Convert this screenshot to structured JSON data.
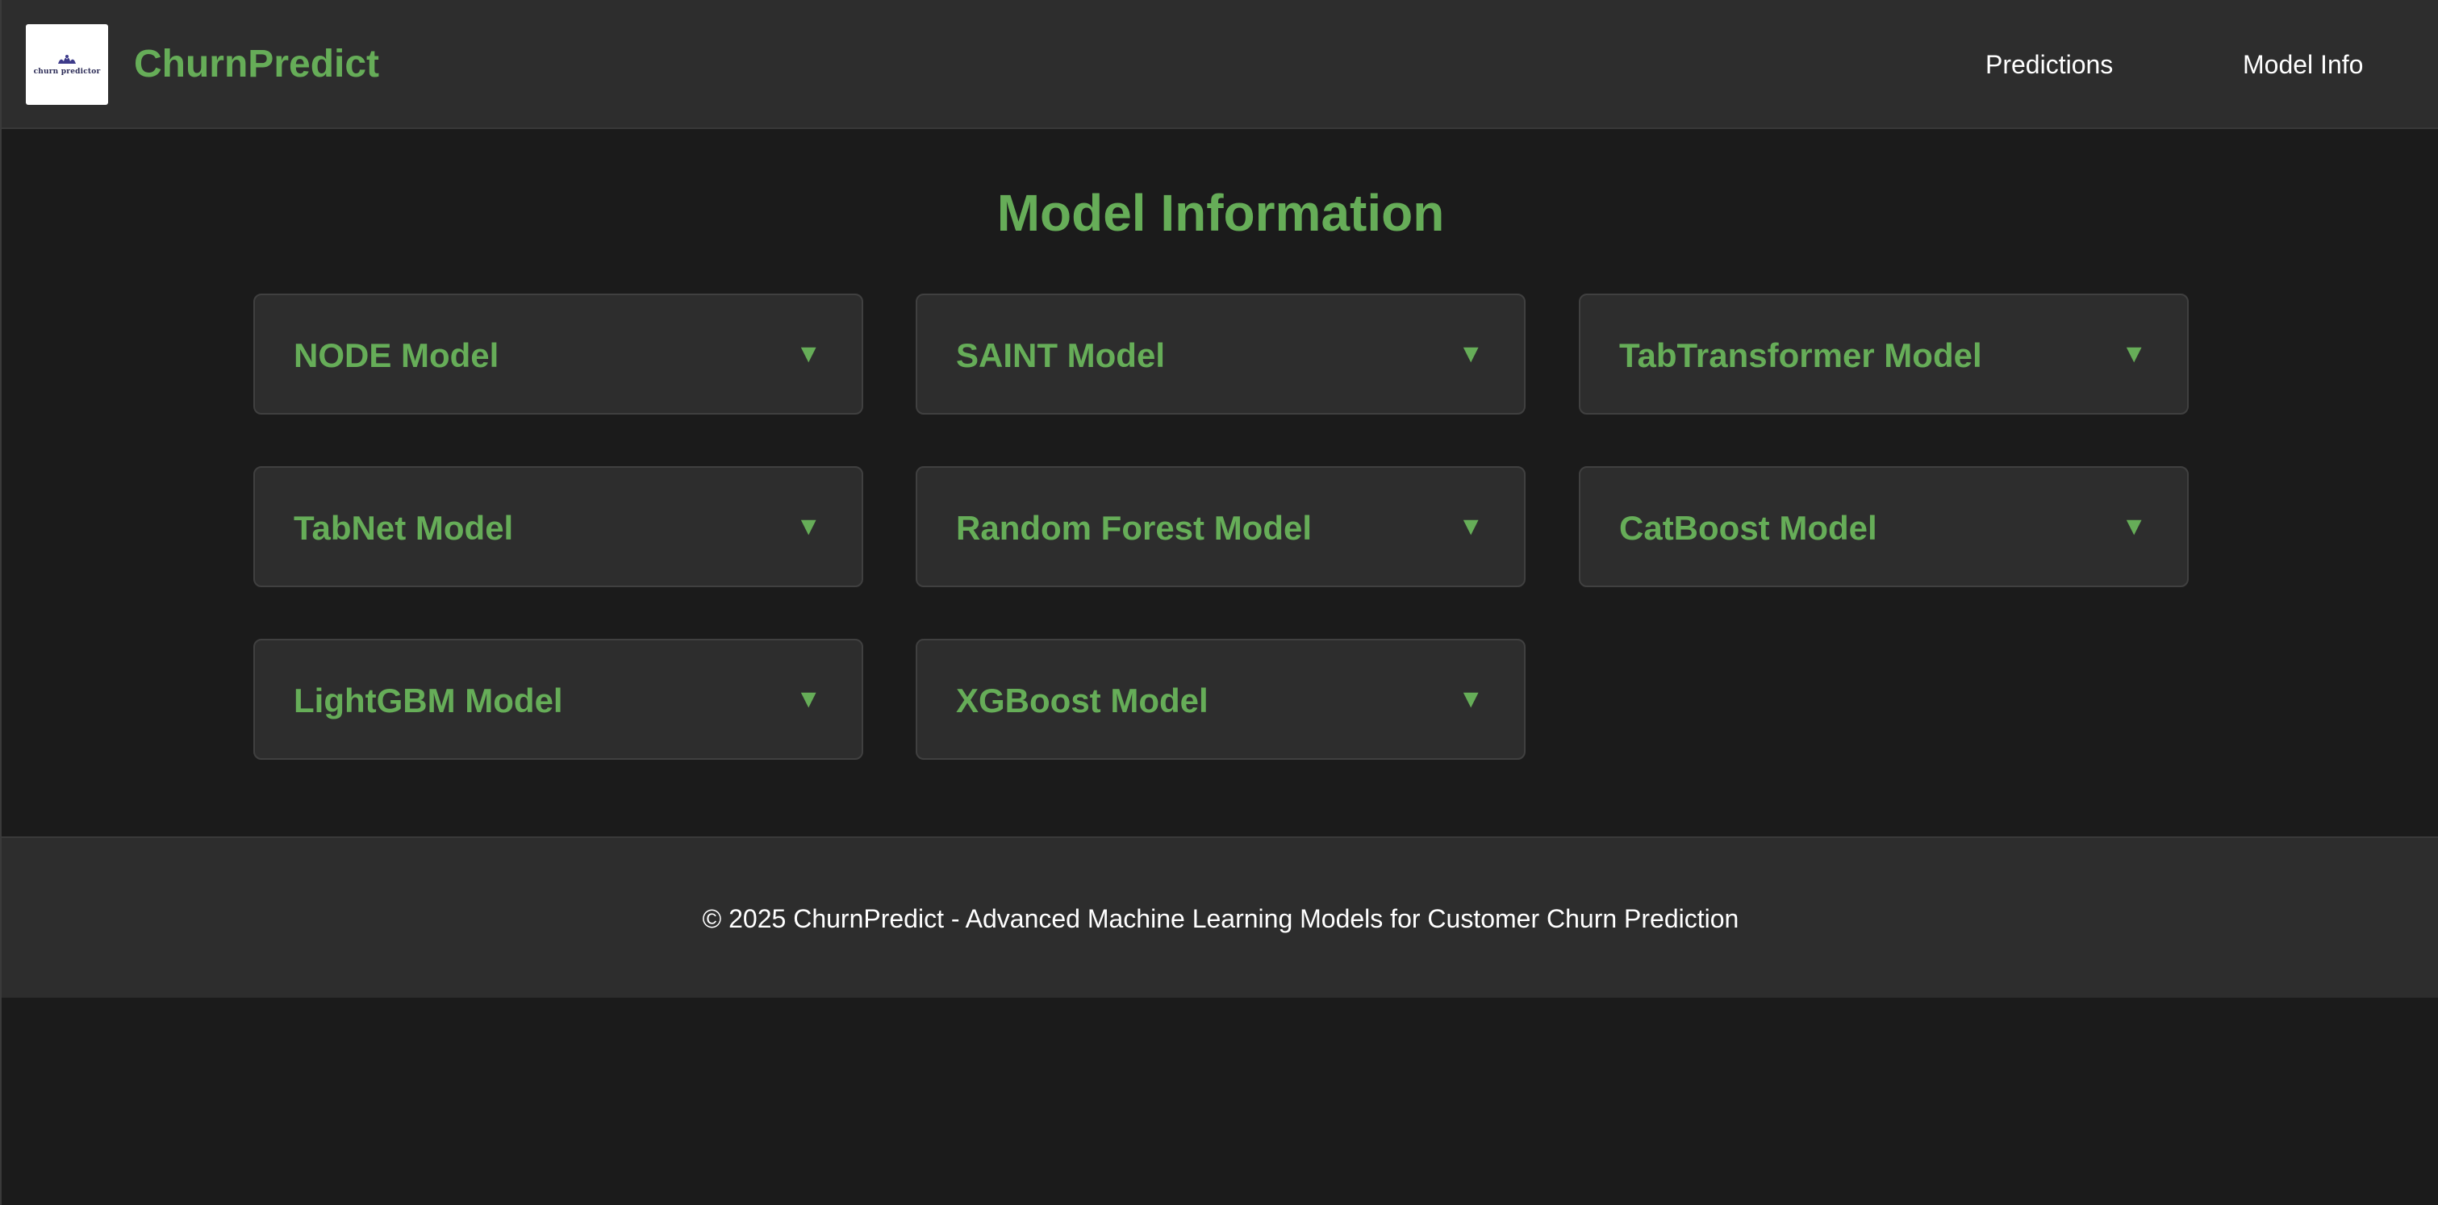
{
  "header": {
    "logo_text": "churn predictor",
    "brand": "ChurnPredict",
    "nav": [
      {
        "label": "Predictions"
      },
      {
        "label": "Model Info"
      }
    ]
  },
  "main": {
    "title": "Model Information",
    "models": [
      {
        "label": "NODE Model",
        "expand_icon": "▼"
      },
      {
        "label": "SAINT Model",
        "expand_icon": "▼"
      },
      {
        "label": "TabTransformer Model",
        "expand_icon": "▼"
      },
      {
        "label": "TabNet Model",
        "expand_icon": "▼"
      },
      {
        "label": "Random Forest Model",
        "expand_icon": "▼"
      },
      {
        "label": "CatBoost Model",
        "expand_icon": "▼"
      },
      {
        "label": "LightGBM Model",
        "expand_icon": "▼"
      },
      {
        "label": "XGBoost Model",
        "expand_icon": "▼"
      }
    ]
  },
  "footer": {
    "text": "© 2025 ChurnPredict - Advanced Machine Learning Models for Customer Churn Prediction"
  },
  "colors": {
    "accent": "#66ad58",
    "background": "#1b1b1b",
    "surface": "#2d2d2d",
    "text": "#ffffff"
  }
}
